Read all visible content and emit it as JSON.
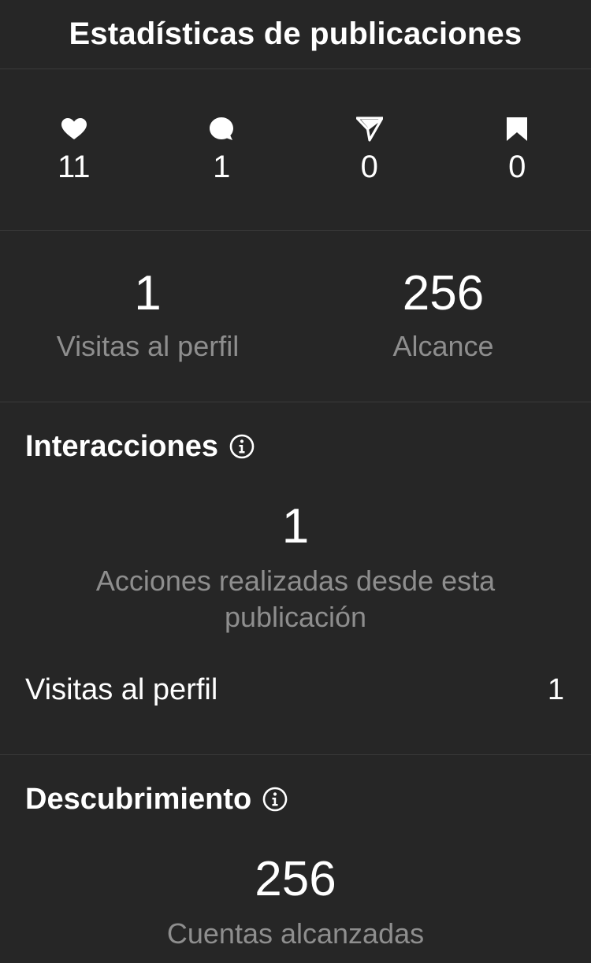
{
  "header": {
    "title": "Estadísticas de publicaciones"
  },
  "post_stats": [
    {
      "icon": "heart-icon",
      "value": "11"
    },
    {
      "icon": "comment-icon",
      "value": "1"
    },
    {
      "icon": "send-icon",
      "value": "0"
    },
    {
      "icon": "bookmark-icon",
      "value": "0"
    }
  ],
  "summary": {
    "profile_visits": {
      "value": "1",
      "label": "Visitas al perfil"
    },
    "reach": {
      "value": "256",
      "label": "Alcance"
    }
  },
  "interactions": {
    "title": "Interacciones",
    "value": "1",
    "label": "Acciones realizadas desde esta publicación",
    "rows": [
      {
        "label": "Visitas al perfil",
        "value": "1"
      }
    ]
  },
  "discovery": {
    "title": "Descubrimiento",
    "value": "256",
    "label": "Cuentas alcanzadas"
  },
  "colors": {
    "background": "#262626",
    "divider": "#3a3a3a",
    "secondary_text": "#8e8e8e",
    "primary_text": "#ffffff"
  }
}
